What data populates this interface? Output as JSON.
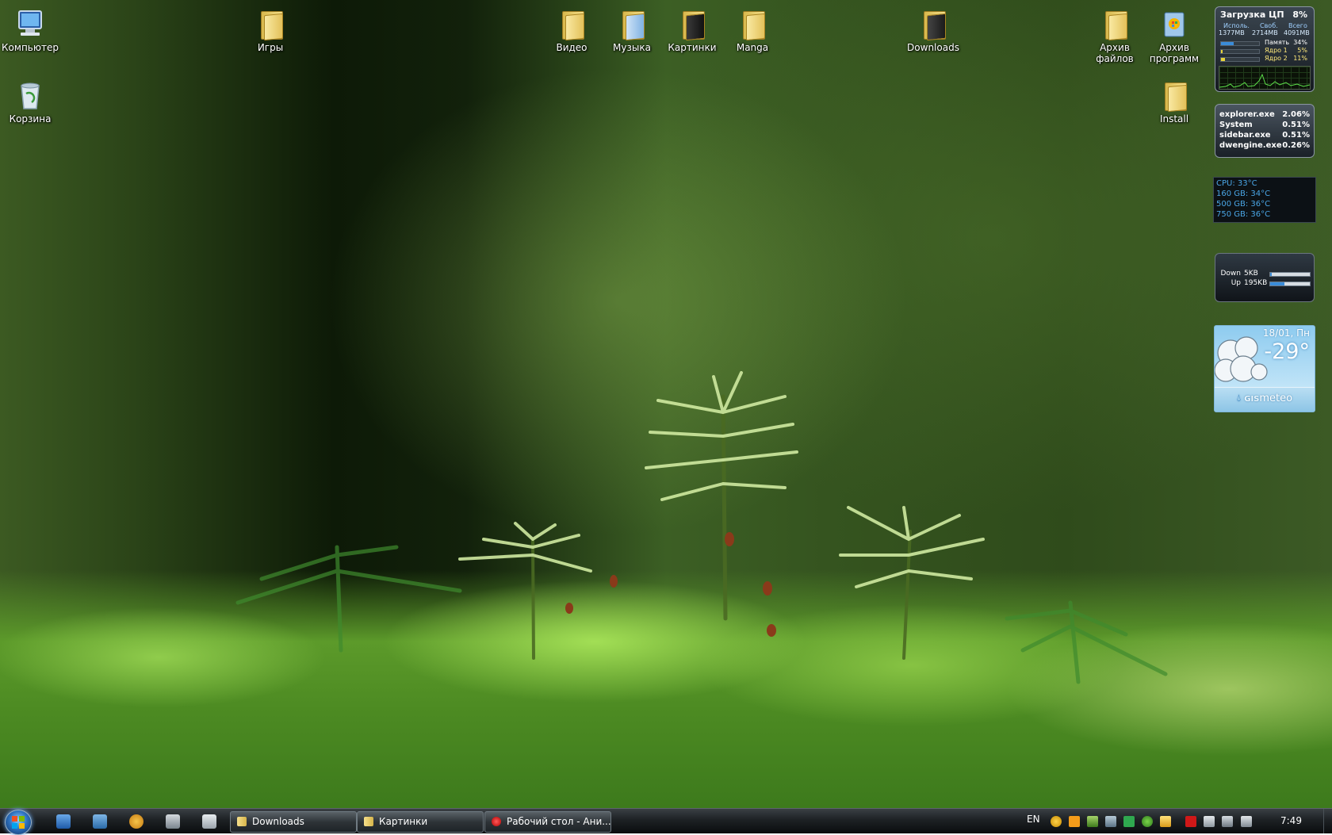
{
  "desktop_icons": {
    "computer": "Компьютер",
    "games": "Игры",
    "video": "Видео",
    "music": "Музыка",
    "pictures": "Картинки",
    "manga": "Manga",
    "downloads": "Downloads",
    "file_archive": "Архив файлов",
    "program_archive": "Архив программ",
    "recycle_bin": "Корзина",
    "install": "Install"
  },
  "cpu_gadget": {
    "title": "Загрузка ЦП",
    "cpu_percent": "8%",
    "headers": [
      "Исполь.",
      "Своб.",
      "Всего"
    ],
    "values": [
      "1377MB",
      "2714MB",
      "4091MB"
    ],
    "rows": [
      {
        "label": "Память",
        "percent": "34%",
        "fill": 0.34
      },
      {
        "label": "Ядро 1",
        "percent": "5%",
        "fill": 0.05
      },
      {
        "label": "Ядро 2",
        "percent": "11%",
        "fill": 0.11
      }
    ]
  },
  "process_gadget": {
    "rows": [
      {
        "name": "explorer.exe",
        "value": "2.06%"
      },
      {
        "name": "System",
        "value": "0.51%"
      },
      {
        "name": "sidebar.exe",
        "value": "0.51%"
      },
      {
        "name": "dwengine.exe",
        "value": "0.26%"
      }
    ]
  },
  "temp_gadget": {
    "rows": [
      "CPU: 33°C",
      "160 GB: 34°C",
      "500 GB: 36°C",
      "750 GB: 36°C"
    ]
  },
  "net_gadget": {
    "down_label": "Down",
    "down_value": "5KB",
    "down_fill": 0.03,
    "up_label": "Up",
    "up_value": "195KB",
    "up_fill": 0.35
  },
  "weather_gadget": {
    "date": "18/01, Пн",
    "temperature": "-29°",
    "logo_gis": "GIS",
    "logo_meteo": "meteo"
  },
  "taskbar": {
    "tasks": [
      {
        "label": "Downloads"
      },
      {
        "label": "Картинки"
      },
      {
        "label": "Рабочий стол - Ани..."
      }
    ],
    "language": "EN",
    "clock": "7:49"
  },
  "colors": {
    "accent": "#3a8cd9",
    "taskbar": "#1d2124",
    "temp_text": "#4aa6e6"
  }
}
